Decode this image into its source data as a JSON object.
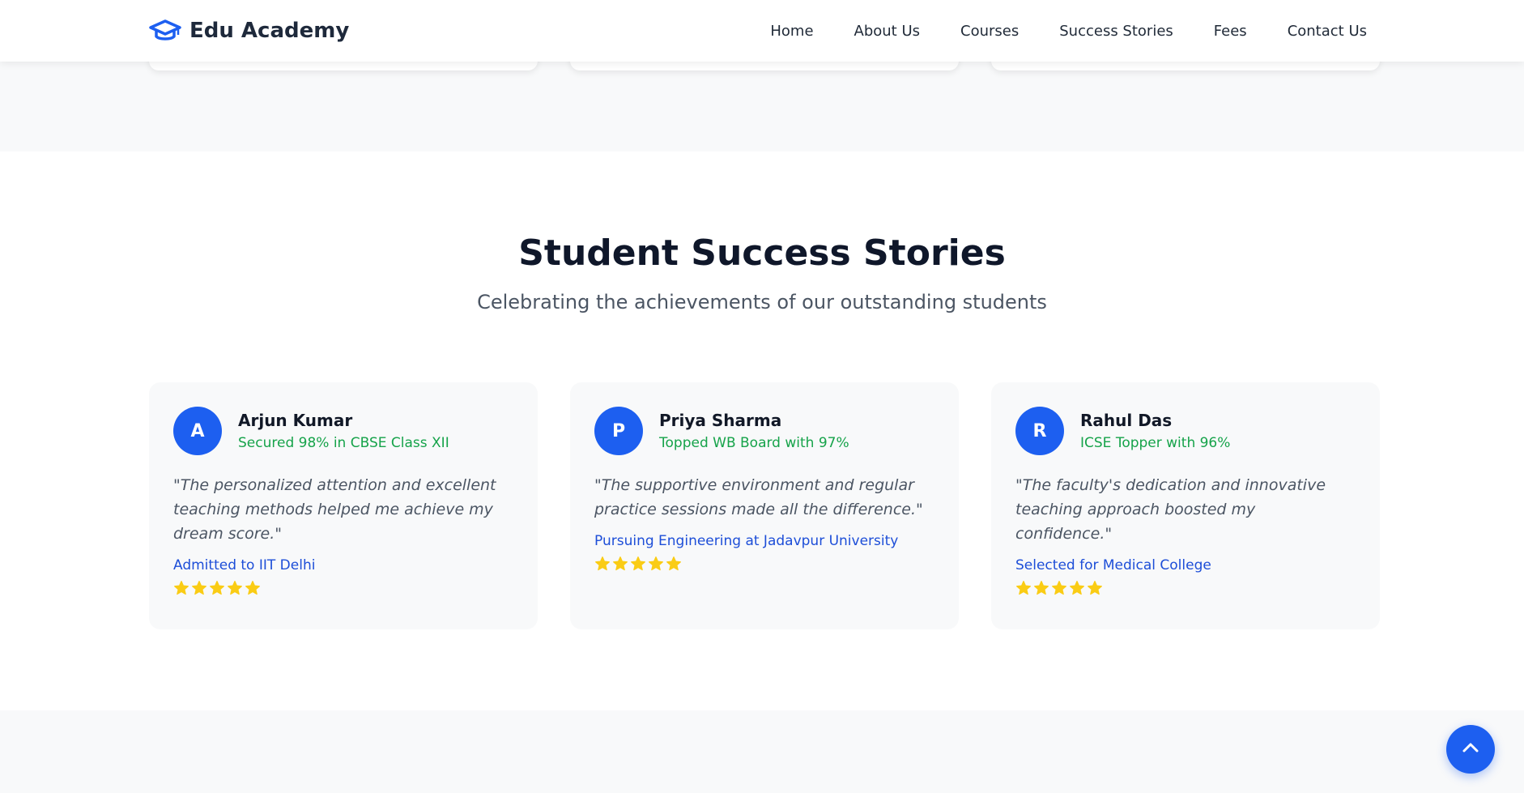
{
  "brand": {
    "name": "Edu Academy",
    "icon": "graduation-cap-icon",
    "color": "#1d5ff0"
  },
  "nav": {
    "links": [
      "Home",
      "About Us",
      "Courses",
      "Success Stories",
      "Fees",
      "Contact Us"
    ]
  },
  "success": {
    "title": "Student Success Stories",
    "subtitle": "Celebrating the achievements of our outstanding students",
    "stories": [
      {
        "initial": "A",
        "name": "Arjun Kumar",
        "achievement": "Secured 98% in CBSE Class XII",
        "quote": "\"The personalized attention and excellent teaching methods helped me achieve my dream score.\"",
        "outcome": "Admitted to IIT Delhi",
        "rating": 5
      },
      {
        "initial": "P",
        "name": "Priya Sharma",
        "achievement": "Topped WB Board with 97%",
        "quote": "\"The supportive environment and regular practice sessions made all the difference.\"",
        "outcome": "Pursuing Engineering at Jadavpur University",
        "rating": 5
      },
      {
        "initial": "R",
        "name": "Rahul Das",
        "achievement": "ICSE Topper with 96%",
        "quote": "\"The faculty's dedication and innovative teaching approach boosted my confidence.\"",
        "outcome": "Selected for Medical College",
        "rating": 5
      }
    ]
  },
  "colors": {
    "accent": "#1d5ff0",
    "achievement": "#16a34a",
    "outcome": "#1d4ed8",
    "star": "#facc15"
  },
  "back_to_top": {
    "icon": "chevron-up-icon"
  }
}
